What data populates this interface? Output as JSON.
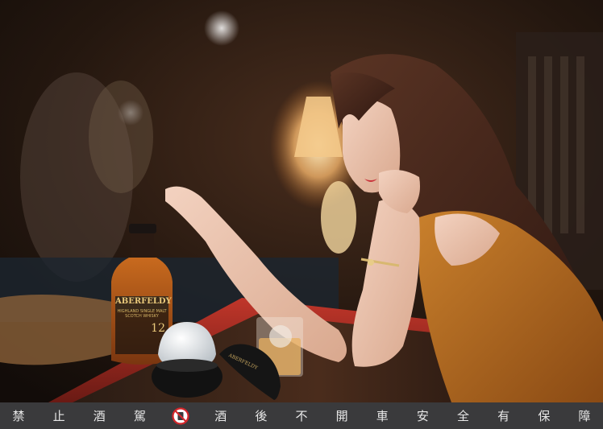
{
  "bottle": {
    "brand": "ABERFELDY",
    "line1": "HIGHLAND SINGLE MALT",
    "line2": "SCOTCH WHISKY",
    "age": "12"
  },
  "ice_case": {
    "brand": "ABERFELDY"
  },
  "footer": {
    "chars": [
      "禁",
      "止",
      "酒",
      "駕",
      "酒",
      "後",
      "不",
      "開",
      "車",
      "安",
      "全",
      "有",
      "保",
      "障"
    ],
    "icon": "no-drinking-icon",
    "colors": {
      "bar": "#3a3a3c",
      "text": "#e8e8e8",
      "icon_red": "#d3272b"
    }
  }
}
